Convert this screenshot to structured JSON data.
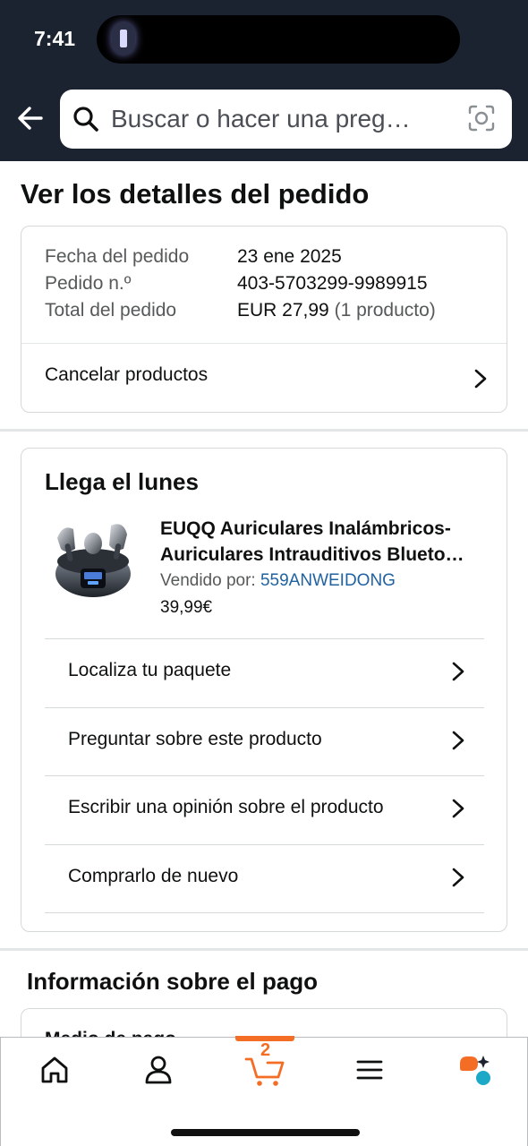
{
  "status_bar": {
    "time": "7:41"
  },
  "search": {
    "placeholder": "Buscar o hacer una preg…"
  },
  "page_title": "Ver los detalles del pedido",
  "summary": {
    "rows": [
      {
        "label": "Fecha del pedido",
        "value": "23 ene 2025",
        "extra": ""
      },
      {
        "label": "Pedido n.º",
        "value": "403-5703299-9989915",
        "extra": ""
      },
      {
        "label": "Total del pedido",
        "value": "EUR 27,99",
        "extra": "(1 producto)"
      }
    ],
    "cancel_label": "Cancelar productos"
  },
  "delivery": {
    "title": "Llega el lunes",
    "product": {
      "title_line1": "EUQQ Auriculares Inalámbricos-",
      "title_line2": "Auriculares Intrauditivos Blueto…",
      "sold_by_label": "Vendido por:",
      "seller": "559ANWEIDONG",
      "price": "39,99€"
    },
    "actions": [
      "Localiza tu paquete",
      "Preguntar sobre este producto",
      "Escribir una opinión sobre el producto",
      "Comprarlo de nuevo"
    ]
  },
  "payment": {
    "title": "Información sobre el pago",
    "card_heading": "Medio de pago"
  },
  "bottom_nav": {
    "items": [
      "home-icon",
      "account-icon",
      "cart-icon",
      "menu-icon",
      "rufus-icon"
    ],
    "cart_count": "2",
    "accent": "#f36d25"
  },
  "colors": {
    "header_bg": "#1c2330",
    "link": "#2162a1"
  }
}
